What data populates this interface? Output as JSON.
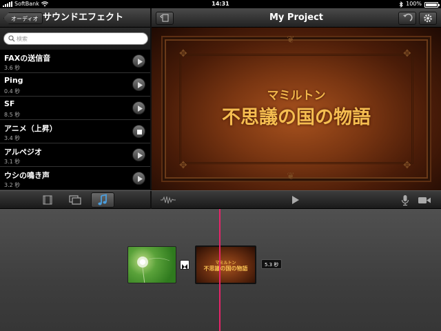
{
  "status_bar": {
    "carrier": "SoftBank",
    "time": "14:31",
    "battery": "100%"
  },
  "sound_browser": {
    "back_label": "オーディオ",
    "title": "サウンドエフェクト",
    "search_placeholder": "検索",
    "items": [
      {
        "name": "FAXの送信音",
        "duration": "3.6 秒",
        "state": "play"
      },
      {
        "name": "Ping",
        "duration": "0.4 秒",
        "state": "play"
      },
      {
        "name": "SF",
        "duration": "8.5 秒",
        "state": "play"
      },
      {
        "name": "アニメ（上昇）",
        "duration": "3.4 秒",
        "state": "stop"
      },
      {
        "name": "アルペジオ",
        "duration": "3.1 秒",
        "state": "play"
      },
      {
        "name": "ウシの鳴き声",
        "duration": "3.2 秒",
        "state": "play"
      }
    ]
  },
  "project": {
    "title": "My Project"
  },
  "preview": {
    "subtitle": "マミルトン",
    "title": "不思議の国の物語"
  },
  "timeline": {
    "clip2_subtitle": "マミルトン",
    "clip2_title": "不思議の国の物語",
    "duration_badge": "5.3 秒"
  },
  "colors": {
    "playhead": "#e8246a",
    "title_gold": "#f5bd50",
    "active_tab": "#4a9ede"
  }
}
